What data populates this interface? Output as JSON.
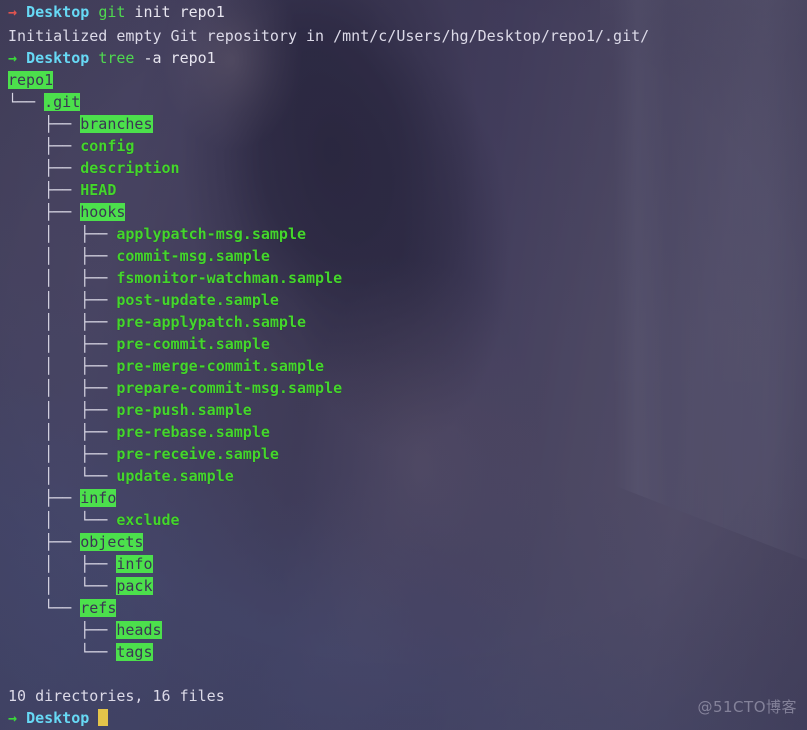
{
  "terminal": {
    "bg_color": "#474260",
    "fg_color": "#e8e6f0",
    "dir_highlight_color": "#4ce04c",
    "file_color": "#44d62c",
    "prompt_host_color": "#67d9f5",
    "cursor_color": "#e3c44a",
    "arrow_error_color": "#e2544f",
    "arrow_ok_color": "#3bd93b"
  },
  "session": {
    "prompt_arrow": "→",
    "prompt_dir": "Desktop",
    "cursor": " "
  },
  "lines": {
    "cmd1_program": "git",
    "cmd1_args": " init repo1",
    "output1": "Initialized empty Git repository in /mnt/c/Users/hg/Desktop/repo1/.git/",
    "cmd2_program": "tree",
    "cmd2_args": " -a repo1",
    "summary": "10 directories, 16 files"
  },
  "tree": [
    {
      "prefix": "",
      "name": "repo1",
      "kind": "dir"
    },
    {
      "prefix": "└── ",
      "name": ".git",
      "kind": "dir"
    },
    {
      "prefix": "    ├── ",
      "name": "branches",
      "kind": "dir"
    },
    {
      "prefix": "    ├── ",
      "name": "config",
      "kind": "file"
    },
    {
      "prefix": "    ├── ",
      "name": "description",
      "kind": "file"
    },
    {
      "prefix": "    ├── ",
      "name": "HEAD",
      "kind": "file"
    },
    {
      "prefix": "    ├── ",
      "name": "hooks",
      "kind": "dir"
    },
    {
      "prefix": "    │   ├── ",
      "name": "applypatch-msg.sample",
      "kind": "file"
    },
    {
      "prefix": "    │   ├── ",
      "name": "commit-msg.sample",
      "kind": "file"
    },
    {
      "prefix": "    │   ├── ",
      "name": "fsmonitor-watchman.sample",
      "kind": "file"
    },
    {
      "prefix": "    │   ├── ",
      "name": "post-update.sample",
      "kind": "file"
    },
    {
      "prefix": "    │   ├── ",
      "name": "pre-applypatch.sample",
      "kind": "file"
    },
    {
      "prefix": "    │   ├── ",
      "name": "pre-commit.sample",
      "kind": "file"
    },
    {
      "prefix": "    │   ├── ",
      "name": "pre-merge-commit.sample",
      "kind": "file"
    },
    {
      "prefix": "    │   ├── ",
      "name": "prepare-commit-msg.sample",
      "kind": "file"
    },
    {
      "prefix": "    │   ├── ",
      "name": "pre-push.sample",
      "kind": "file"
    },
    {
      "prefix": "    │   ├── ",
      "name": "pre-rebase.sample",
      "kind": "file"
    },
    {
      "prefix": "    │   ├── ",
      "name": "pre-receive.sample",
      "kind": "file"
    },
    {
      "prefix": "    │   └── ",
      "name": "update.sample",
      "kind": "file"
    },
    {
      "prefix": "    ├── ",
      "name": "info",
      "kind": "dir"
    },
    {
      "prefix": "    │   └── ",
      "name": "exclude",
      "kind": "file"
    },
    {
      "prefix": "    ├── ",
      "name": "objects",
      "kind": "dir"
    },
    {
      "prefix": "    │   ├── ",
      "name": "info",
      "kind": "dir"
    },
    {
      "prefix": "    │   └── ",
      "name": "pack",
      "kind": "dir"
    },
    {
      "prefix": "    └── ",
      "name": "refs",
      "kind": "dir"
    },
    {
      "prefix": "        ├── ",
      "name": "heads",
      "kind": "dir"
    },
    {
      "prefix": "        └── ",
      "name": "tags",
      "kind": "dir"
    }
  ],
  "watermark": {
    "text": "@51CTO博客"
  }
}
